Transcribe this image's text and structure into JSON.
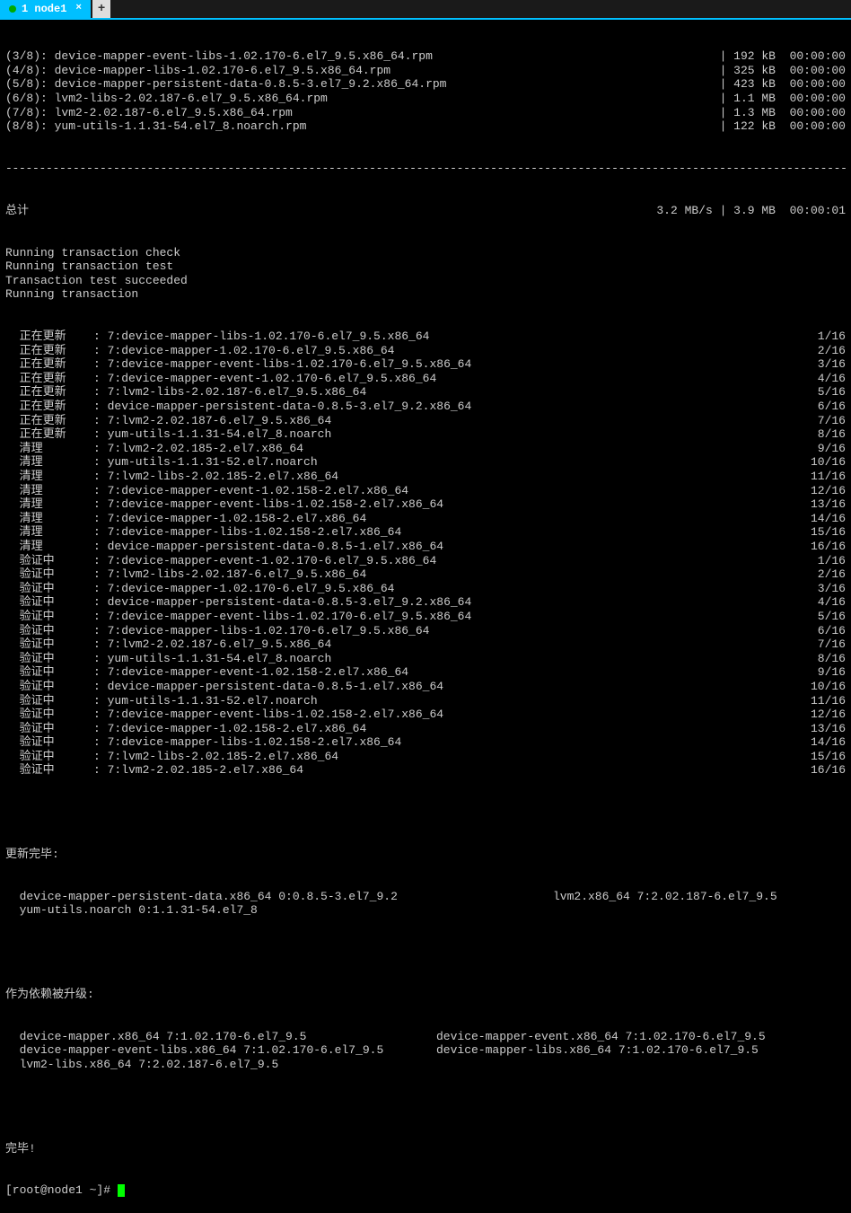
{
  "tab": {
    "label": "1 node1",
    "close": "×"
  },
  "downloads": [
    {
      "left": "(3/8): device-mapper-event-libs-1.02.170-6.el7_9.5.x86_64.rpm",
      "right": "| 192 kB  00:00:00"
    },
    {
      "left": "(4/8): device-mapper-libs-1.02.170-6.el7_9.5.x86_64.rpm",
      "right": "| 325 kB  00:00:00"
    },
    {
      "left": "(5/8): device-mapper-persistent-data-0.8.5-3.el7_9.2.x86_64.rpm",
      "right": "| 423 kB  00:00:00"
    },
    {
      "left": "(6/8): lvm2-libs-2.02.187-6.el7_9.5.x86_64.rpm",
      "right": "| 1.1 MB  00:00:00"
    },
    {
      "left": "(7/8): lvm2-2.02.187-6.el7_9.5.x86_64.rpm",
      "right": "| 1.3 MB  00:00:00"
    },
    {
      "left": "(8/8): yum-utils-1.1.31-54.el7_8.noarch.rpm",
      "right": "| 122 kB  00:00:00"
    }
  ],
  "dashes": "--------------------------------------------------------------------------------------------------------------------------------------------------",
  "total": {
    "label": "总计",
    "right": "3.2 MB/s | 3.9 MB  00:00:01"
  },
  "stages": [
    "Running transaction check",
    "Running transaction test",
    "Transaction test succeeded",
    "Running transaction"
  ],
  "transactions": [
    {
      "action": "  正在更新",
      "pkg": ": 7:device-mapper-libs-1.02.170-6.el7_9.5.x86_64",
      "count": "1/16"
    },
    {
      "action": "  正在更新",
      "pkg": ": 7:device-mapper-1.02.170-6.el7_9.5.x86_64",
      "count": "2/16"
    },
    {
      "action": "  正在更新",
      "pkg": ": 7:device-mapper-event-libs-1.02.170-6.el7_9.5.x86_64",
      "count": "3/16"
    },
    {
      "action": "  正在更新",
      "pkg": ": 7:device-mapper-event-1.02.170-6.el7_9.5.x86_64",
      "count": "4/16"
    },
    {
      "action": "  正在更新",
      "pkg": ": 7:lvm2-libs-2.02.187-6.el7_9.5.x86_64",
      "count": "5/16"
    },
    {
      "action": "  正在更新",
      "pkg": ": device-mapper-persistent-data-0.8.5-3.el7_9.2.x86_64",
      "count": "6/16"
    },
    {
      "action": "  正在更新",
      "pkg": ": 7:lvm2-2.02.187-6.el7_9.5.x86_64",
      "count": "7/16"
    },
    {
      "action": "  正在更新",
      "pkg": ": yum-utils-1.1.31-54.el7_8.noarch",
      "count": "8/16"
    },
    {
      "action": "  清理",
      "pkg": ": 7:lvm2-2.02.185-2.el7.x86_64",
      "count": "9/16"
    },
    {
      "action": "  清理",
      "pkg": ": yum-utils-1.1.31-52.el7.noarch",
      "count": "10/16"
    },
    {
      "action": "  清理",
      "pkg": ": 7:lvm2-libs-2.02.185-2.el7.x86_64",
      "count": "11/16"
    },
    {
      "action": "  清理",
      "pkg": ": 7:device-mapper-event-1.02.158-2.el7.x86_64",
      "count": "12/16"
    },
    {
      "action": "  清理",
      "pkg": ": 7:device-mapper-event-libs-1.02.158-2.el7.x86_64",
      "count": "13/16"
    },
    {
      "action": "  清理",
      "pkg": ": 7:device-mapper-1.02.158-2.el7.x86_64",
      "count": "14/16"
    },
    {
      "action": "  清理",
      "pkg": ": 7:device-mapper-libs-1.02.158-2.el7.x86_64",
      "count": "15/16"
    },
    {
      "action": "  清理",
      "pkg": ": device-mapper-persistent-data-0.8.5-1.el7.x86_64",
      "count": "16/16"
    },
    {
      "action": "  验证中",
      "pkg": ": 7:device-mapper-event-1.02.170-6.el7_9.5.x86_64",
      "count": "1/16"
    },
    {
      "action": "  验证中",
      "pkg": ": 7:lvm2-libs-2.02.187-6.el7_9.5.x86_64",
      "count": "2/16"
    },
    {
      "action": "  验证中",
      "pkg": ": 7:device-mapper-1.02.170-6.el7_9.5.x86_64",
      "count": "3/16"
    },
    {
      "action": "  验证中",
      "pkg": ": device-mapper-persistent-data-0.8.5-3.el7_9.2.x86_64",
      "count": "4/16"
    },
    {
      "action": "  验证中",
      "pkg": ": 7:device-mapper-event-libs-1.02.170-6.el7_9.5.x86_64",
      "count": "5/16"
    },
    {
      "action": "  验证中",
      "pkg": ": 7:device-mapper-libs-1.02.170-6.el7_9.5.x86_64",
      "count": "6/16"
    },
    {
      "action": "  验证中",
      "pkg": ": 7:lvm2-2.02.187-6.el7_9.5.x86_64",
      "count": "7/16"
    },
    {
      "action": "  验证中",
      "pkg": ": yum-utils-1.1.31-54.el7_8.noarch",
      "count": "8/16"
    },
    {
      "action": "  验证中",
      "pkg": ": 7:device-mapper-event-1.02.158-2.el7.x86_64",
      "count": "9/16"
    },
    {
      "action": "  验证中",
      "pkg": ": device-mapper-persistent-data-0.8.5-1.el7.x86_64",
      "count": "10/16"
    },
    {
      "action": "  验证中",
      "pkg": ": yum-utils-1.1.31-52.el7.noarch",
      "count": "11/16"
    },
    {
      "action": "  验证中",
      "pkg": ": 7:device-mapper-event-libs-1.02.158-2.el7.x86_64",
      "count": "12/16"
    },
    {
      "action": "  验证中",
      "pkg": ": 7:device-mapper-1.02.158-2.el7.x86_64",
      "count": "13/16"
    },
    {
      "action": "  验证中",
      "pkg": ": 7:device-mapper-libs-1.02.158-2.el7.x86_64",
      "count": "14/16"
    },
    {
      "action": "  验证中",
      "pkg": ": 7:lvm2-libs-2.02.185-2.el7.x86_64",
      "count": "15/16"
    },
    {
      "action": "  验证中",
      "pkg": ": 7:lvm2-2.02.185-2.el7.x86_64",
      "count": "16/16"
    }
  ],
  "updated": {
    "title": "更新完毕:",
    "rows": [
      {
        "c1": "  device-mapper-persistent-data.x86_64 0:0.8.5-3.el7_9.2",
        "c2": "lvm2.x86_64 7:2.02.187-6.el7_9.5"
      },
      {
        "c1": "  yum-utils.noarch 0:1.1.31-54.el7_8",
        "c2": ""
      }
    ]
  },
  "deps": {
    "title": "作为依赖被升级:",
    "rows": [
      {
        "c1": "  device-mapper.x86_64 7:1.02.170-6.el7_9.5",
        "c2": "device-mapper-event.x86_64 7:1.02.170-6.el7_9.5"
      },
      {
        "c1": "  device-mapper-event-libs.x86_64 7:1.02.170-6.el7_9.5",
        "c2": "device-mapper-libs.x86_64 7:1.02.170-6.el7_9.5"
      },
      {
        "c1": "  lvm2-libs.x86_64 7:2.02.187-6.el7_9.5",
        "c2": ""
      }
    ]
  },
  "complete": "完毕!",
  "prompt": "[root@node1 ~]# "
}
